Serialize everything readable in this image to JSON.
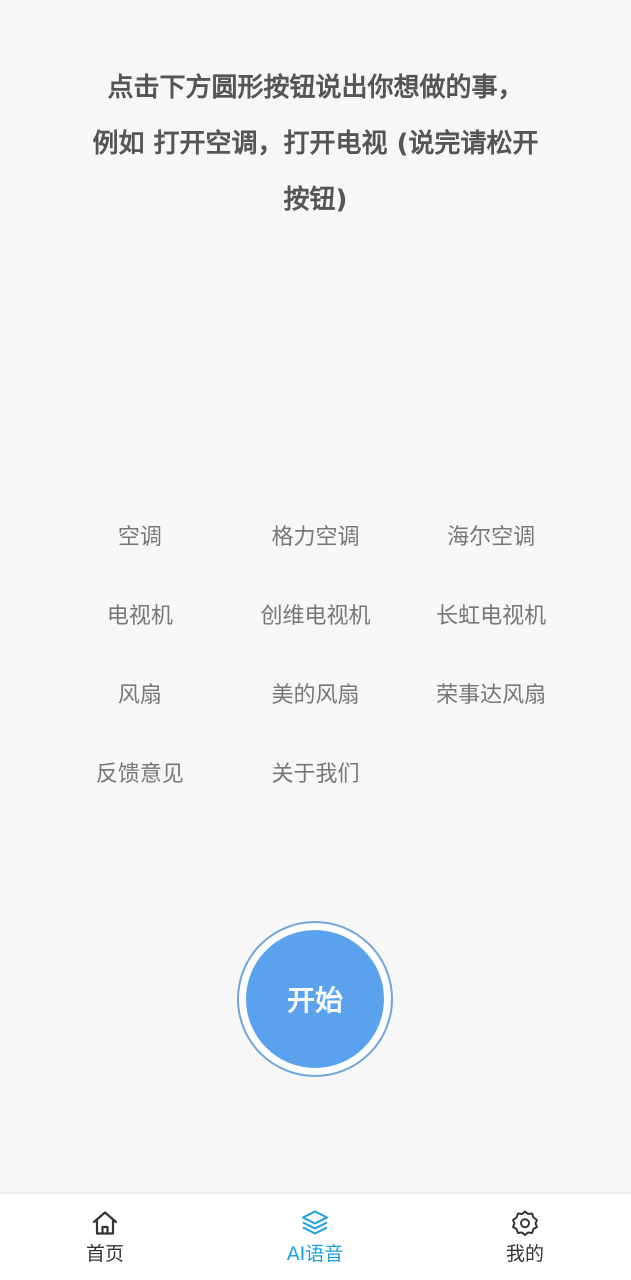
{
  "instruction": {
    "line1": "点击下方圆形按钮说出你想做的事，",
    "line2": "例如 打开空调，打开电视 (说完请松开",
    "line3": "按钮)"
  },
  "commands": [
    "空调",
    "格力空调",
    "海尔空调",
    "电视机",
    "创维电视机",
    "长虹电视机",
    "风扇",
    "美的风扇",
    "荣事达风扇",
    "反馈意见",
    "关于我们"
  ],
  "start_button": {
    "label": "开始"
  },
  "tabbar": {
    "accent_color": "#1b9fe0",
    "tabs": [
      {
        "label": "首页",
        "icon": "home-icon",
        "active": false
      },
      {
        "label": "AI语音",
        "icon": "layers-icon",
        "active": true
      },
      {
        "label": "我的",
        "icon": "gear-icon",
        "active": false
      }
    ]
  }
}
